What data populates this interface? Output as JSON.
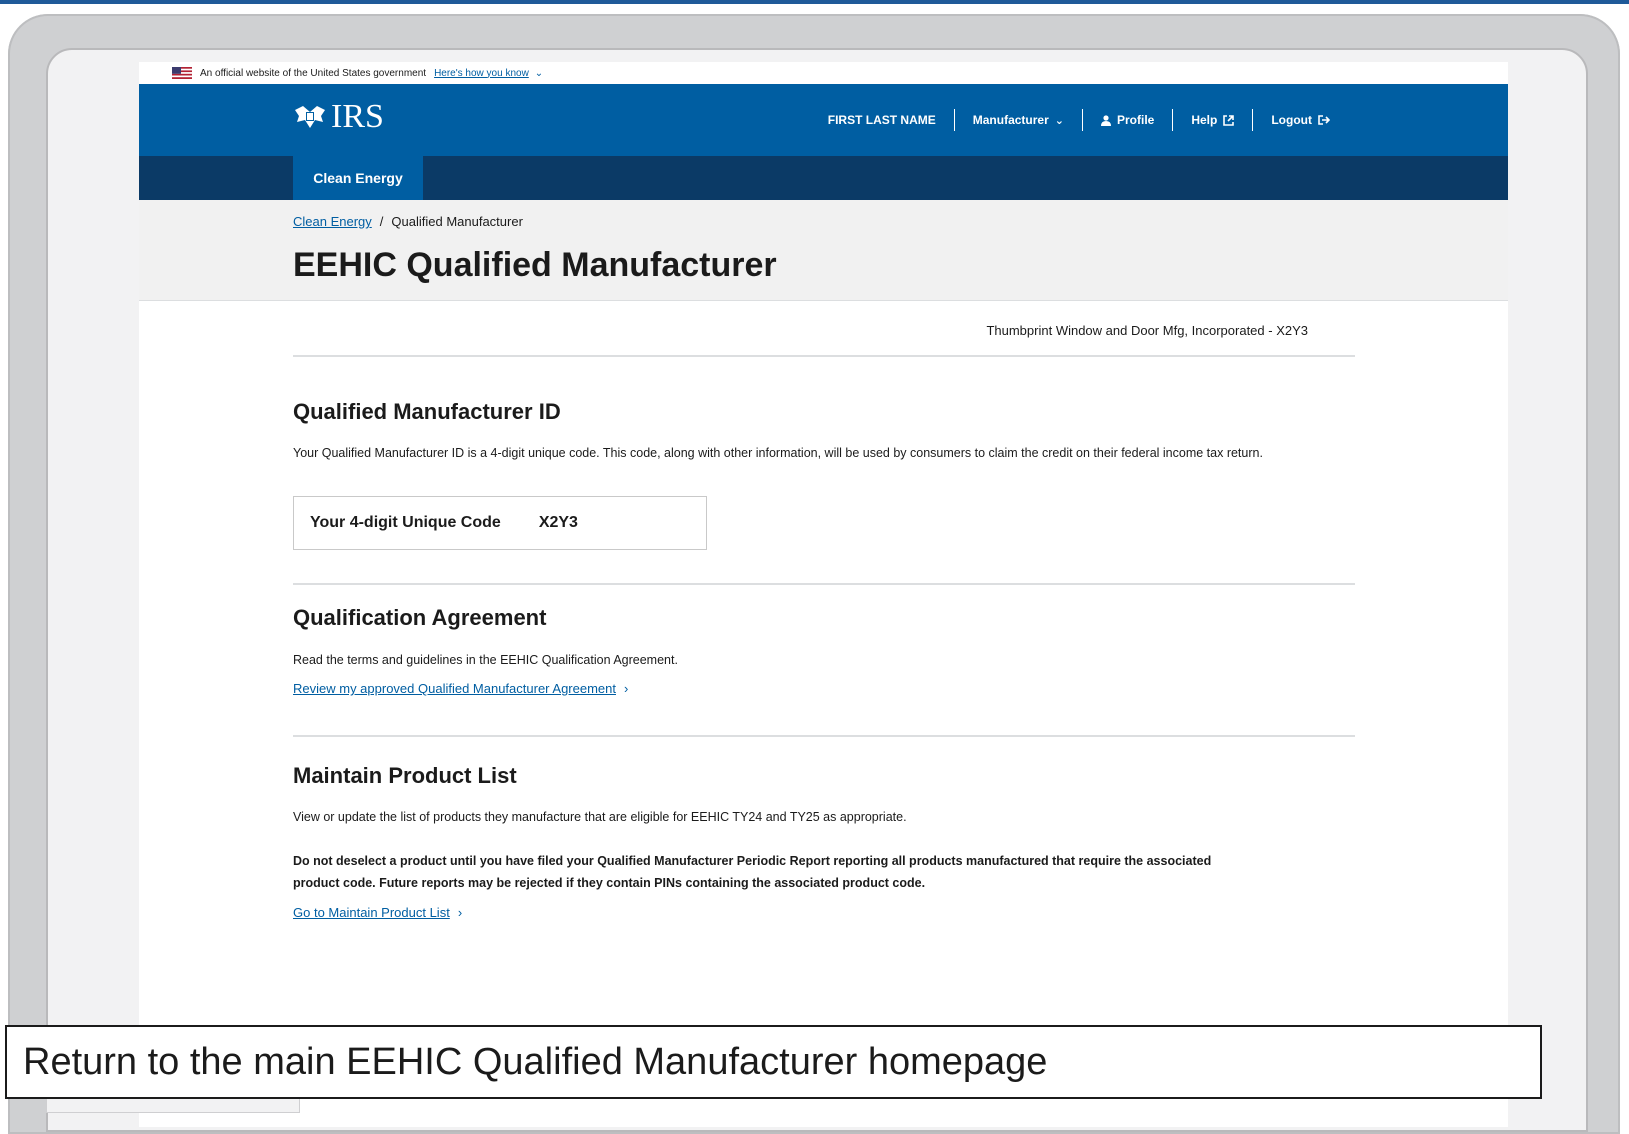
{
  "gov_banner": {
    "text": "An official website of the United States government",
    "link": "Here's how you know"
  },
  "header": {
    "logo_text": "IRS",
    "nav": {
      "user_name": "FIRST LAST NAME",
      "role": "Manufacturer",
      "profile": "Profile",
      "help": "Help",
      "logout": "Logout"
    }
  },
  "subnav": {
    "tab": "Clean Energy"
  },
  "breadcrumb": {
    "home": "Clean Energy",
    "separator": "/",
    "current": "Qualified Manufacturer"
  },
  "page_title": "EEHIC Qualified Manufacturer",
  "company": "Thumbprint Window and Door Mfg, Incorporated - X2Y3",
  "sections": {
    "qm_id": {
      "heading": "Qualified Manufacturer ID",
      "description": "Your Qualified Manufacturer ID is a 4-digit unique code. This code, along with other information, will be used by consumers to claim the credit on their federal income tax return.",
      "code_label": "Your 4-digit Unique Code",
      "code_value": "X2Y3"
    },
    "agreement": {
      "heading": "Qualification Agreement",
      "description": "Read the terms and guidelines in the EEHIC Qualification Agreement.",
      "link": "Review my approved Qualified Manufacturer Agreement"
    },
    "product_list": {
      "heading": "Maintain Product List",
      "description": "View or update the list of products they manufacture that are eligible for EEHIC TY24 and TY25 as appropriate.",
      "warning": "Do not deselect a product until you have filed your Qualified Manufacturer Periodic Report reporting all products manufactured that require the associated product code. Future reports may be rejected if they contain PINs containing the associated product code.",
      "link": "Go to Maintain Product List"
    }
  },
  "caption": "Return to the main EEHIC Qualified Manufacturer homepage",
  "colors": {
    "primary_blue": "#005ea2",
    "dark_blue": "#0b3a66",
    "link_blue": "#005ea2"
  }
}
